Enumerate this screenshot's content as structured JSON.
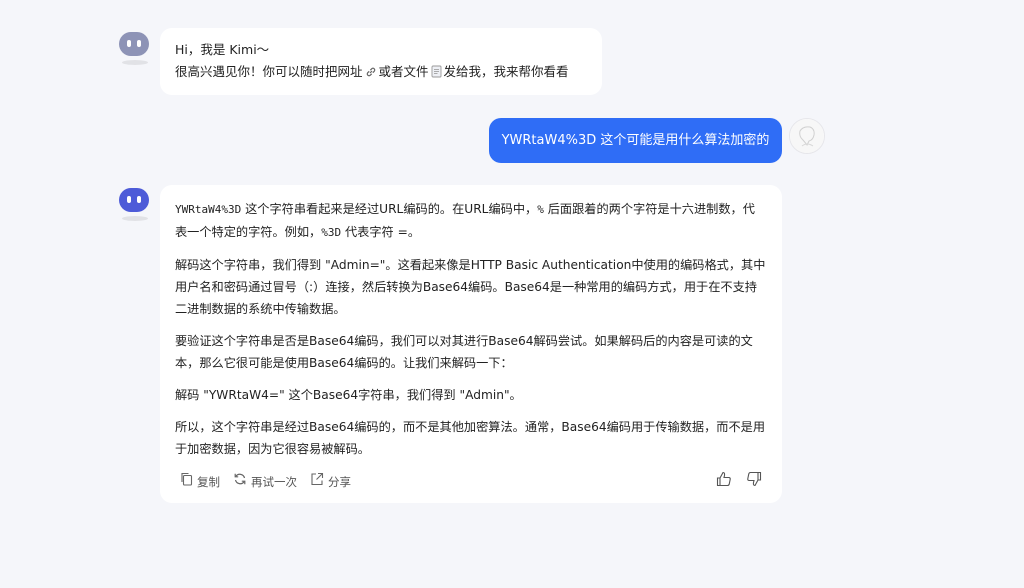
{
  "greeting": {
    "line1": "Hi，我是 Kimi～",
    "line2_part1": "很高兴遇见你！你可以随时把网址",
    "line2_part2": "或者文件",
    "line2_part3": "发给我，我来帮你看看"
  },
  "user_message": {
    "text": "YWRtaW4%3D 这个可能是用什么算法加密的"
  },
  "answer": {
    "p1": {
      "code1": "YWRtaW4%3D",
      "t1": " 这个字符串看起来是经过URL编码的。在URL编码中，",
      "code2": "%",
      "t2": " 后面跟着的两个字符是十六进制数，代表一个特定的字符。例如，",
      "code3": "%3D",
      "t3": " 代表字符 =。"
    },
    "p2": "解码这个字符串，我们得到 \"Admin=\"。这看起来像是HTTP Basic Authentication中使用的编码格式，其中用户名和密码通过冒号（:）连接，然后转换为Base64编码。Base64是一种常用的编码方式，用于在不支持二进制数据的系统中传输数据。",
    "p3": "要验证这个字符串是否是Base64编码，我们可以对其进行Base64解码尝试。如果解码后的内容是可读的文本，那么它很可能是使用Base64编码的。让我们来解码一下：",
    "p4": "解码 \"YWRtaW4=\" 这个Base64字符串，我们得到 \"Admin\"。",
    "p5": "所以，这个字符串是经过Base64编码的，而不是其他加密算法。通常，Base64编码用于传输数据，而不是用于加密数据，因为它很容易被解码。"
  },
  "actions": {
    "copy": "复制",
    "retry": "再试一次",
    "share": "分享"
  },
  "colors": {
    "page_bg": "#f5f6fa",
    "bubble_bg": "#ffffff",
    "user_bubble_bg": "#2f6df6",
    "bot_avatar": "#4d5bd8",
    "bot_avatar_old": "#8d93b6"
  }
}
